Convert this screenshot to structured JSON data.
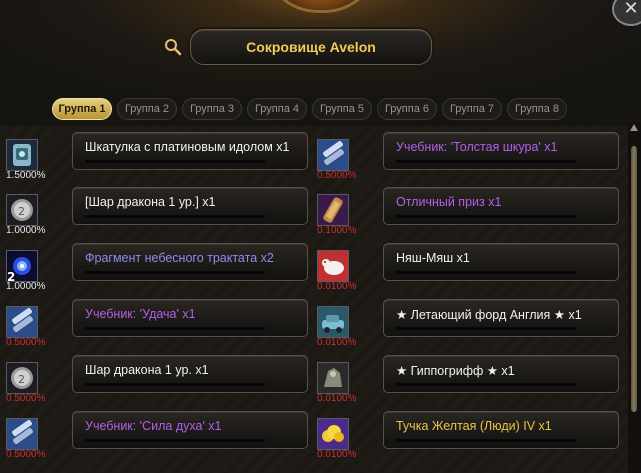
{
  "header": {
    "title": "Сокровище Avelon"
  },
  "tabs": [
    "Группа 1",
    "Группа 2",
    "Группа 3",
    "Группа 4",
    "Группа 5",
    "Группа 6",
    "Группа 7",
    "Группа 8"
  ],
  "left_items": [
    {
      "name": "Шкатулка с платиновым идолом x1",
      "pct": "1.5000%",
      "name_color": "white",
      "pct_color": "white",
      "icon": "scroll-box-icon",
      "count": ""
    },
    {
      "name": "[Шар дракона 1 ур.] x1",
      "pct": "1.0000%",
      "name_color": "white",
      "pct_color": "white",
      "icon": "dragon-orb-icon",
      "count": ""
    },
    {
      "name": "Фрагмент небесного трактата x2",
      "pct": "1.0000%",
      "name_color": "blue",
      "pct_color": "white",
      "icon": "blue-flame-icon",
      "count": "2"
    },
    {
      "name": "Учебник: 'Удача' x1",
      "pct": "0.5000%",
      "name_color": "purple",
      "pct_color": "red",
      "icon": "textbook-icon",
      "count": ""
    },
    {
      "name": "Шар дракона 1 ур. x1",
      "pct": "0.5000%",
      "name_color": "white",
      "pct_color": "red",
      "icon": "dragon-orb-icon",
      "count": ""
    },
    {
      "name": "Учебник: 'Сила духа' x1",
      "pct": "0.5000%",
      "name_color": "purple",
      "pct_color": "red",
      "icon": "textbook-icon",
      "count": ""
    }
  ],
  "right_items": [
    {
      "name": "Учебник: 'Толстая шкура' x1",
      "pct": "0.5000%",
      "name_color": "purple",
      "pct_color": "red",
      "icon": "textbook-icon",
      "count": ""
    },
    {
      "name": "Отличный приз x1",
      "pct": "0.1000%",
      "name_color": "purple",
      "pct_color": "red",
      "icon": "prize-scroll-icon",
      "count": ""
    },
    {
      "name": "Няш-Мяш x1",
      "pct": "0.0100%",
      "name_color": "white",
      "pct_color": "red",
      "icon": "pet-sheep-icon",
      "count": ""
    },
    {
      "name": "★ Летающий форд Англия ★ x1",
      "pct": "0.0100%",
      "name_color": "white",
      "pct_color": "red",
      "icon": "flying-car-icon",
      "count": ""
    },
    {
      "name": "★ Гиппогрифф ★ x1",
      "pct": "0.0100%",
      "name_color": "white",
      "pct_color": "red",
      "icon": "hippogriff-icon",
      "count": ""
    },
    {
      "name": "Тучка Желтая (Люди) IV x1",
      "pct": "0.0100%",
      "name_color": "gold",
      "pct_color": "red",
      "icon": "yellow-cloud-icon",
      "count": ""
    }
  ],
  "icons": {
    "close": "close-icon",
    "search": "search-icon"
  }
}
